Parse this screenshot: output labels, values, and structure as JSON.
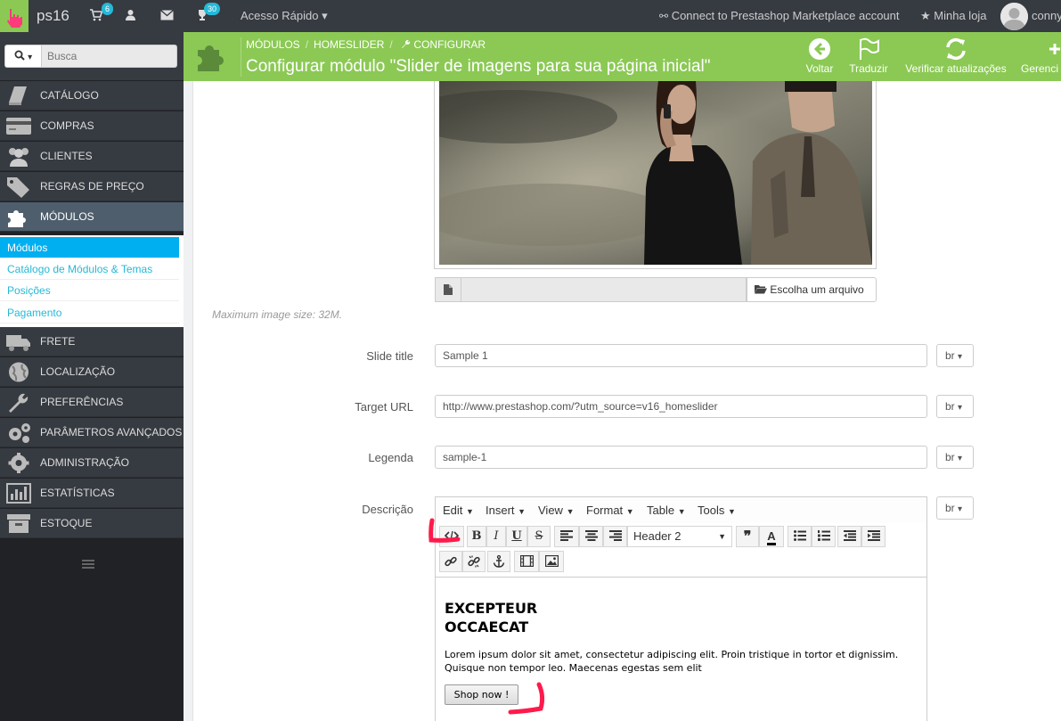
{
  "topbar": {
    "shop_name": "ps16",
    "cart_count": "6",
    "trophy_count": "30",
    "quick_access": "Acesso Rápido",
    "marketplace": "Connect to Prestashop Marketplace account",
    "my_store": "Minha loja",
    "username": "conny"
  },
  "sidebar": {
    "search_placeholder": "Busca",
    "items": [
      {
        "label": "CATÁLOGO"
      },
      {
        "label": "COMPRAS"
      },
      {
        "label": "CLIENTES"
      },
      {
        "label": "REGRAS DE PREÇO"
      },
      {
        "label": "MÓDULOS"
      },
      {
        "label": "FRETE"
      },
      {
        "label": "LOCALIZAÇÃO"
      },
      {
        "label": "PREFERÊNCIAS"
      },
      {
        "label": "PARÂMETROS AVANÇADOS"
      },
      {
        "label": "ADMINISTRAÇÃO"
      },
      {
        "label": "ESTATÍSTICAS"
      },
      {
        "label": "ESTOQUE"
      }
    ],
    "submenu": [
      {
        "label": "Módulos"
      },
      {
        "label": "Catálogo de Módulos & Temas"
      },
      {
        "label": "Posições"
      },
      {
        "label": "Pagamento"
      }
    ]
  },
  "header": {
    "breadcrumb": [
      "MÓDULOS",
      "HOMESLIDER",
      "CONFIGURAR"
    ],
    "title": "Configurar módulo \"Slider de imagens para sua página inicial\"",
    "tools": [
      {
        "label": "Voltar",
        "icon": "arrow-left-circle-icon"
      },
      {
        "label": "Traduzir",
        "icon": "flag-icon"
      },
      {
        "label": "Verificar atualizações",
        "icon": "refresh-icon"
      },
      {
        "label": "Gerenci",
        "icon": "manage-icon"
      }
    ]
  },
  "form": {
    "choose_file": "Escolha um arquivo",
    "max_size": "Maximum image size: 32M.",
    "slide_title_label": "Slide title",
    "slide_title_value": "Sample 1",
    "target_url_label": "Target URL",
    "target_url_value": "http://www.prestashop.com/?utm_source=v16_homeslider",
    "legend_label": "Legenda",
    "legend_value": "sample-1",
    "description_label": "Descrição",
    "lang": "br"
  },
  "editor": {
    "menu": [
      "Edit",
      "Insert",
      "View",
      "Format",
      "Table",
      "Tools"
    ],
    "format_select": "Header 2",
    "heading_line1": "EXCEPTEUR",
    "heading_line2": "OCCAECAT",
    "paragraph": "Lorem ipsum dolor sit amet, consectetur adipiscing elit. Proin tristique in tortor et dignissim. Quisque non tempor leo. Maecenas egestas sem elit",
    "button_label": "Shop now !"
  },
  "colors": {
    "header_green": "#8bc954",
    "topbar": "#363a41",
    "sidebar": "#202226",
    "accent_blue": "#25b9d7",
    "annotation_red": "#ff1a4b"
  }
}
